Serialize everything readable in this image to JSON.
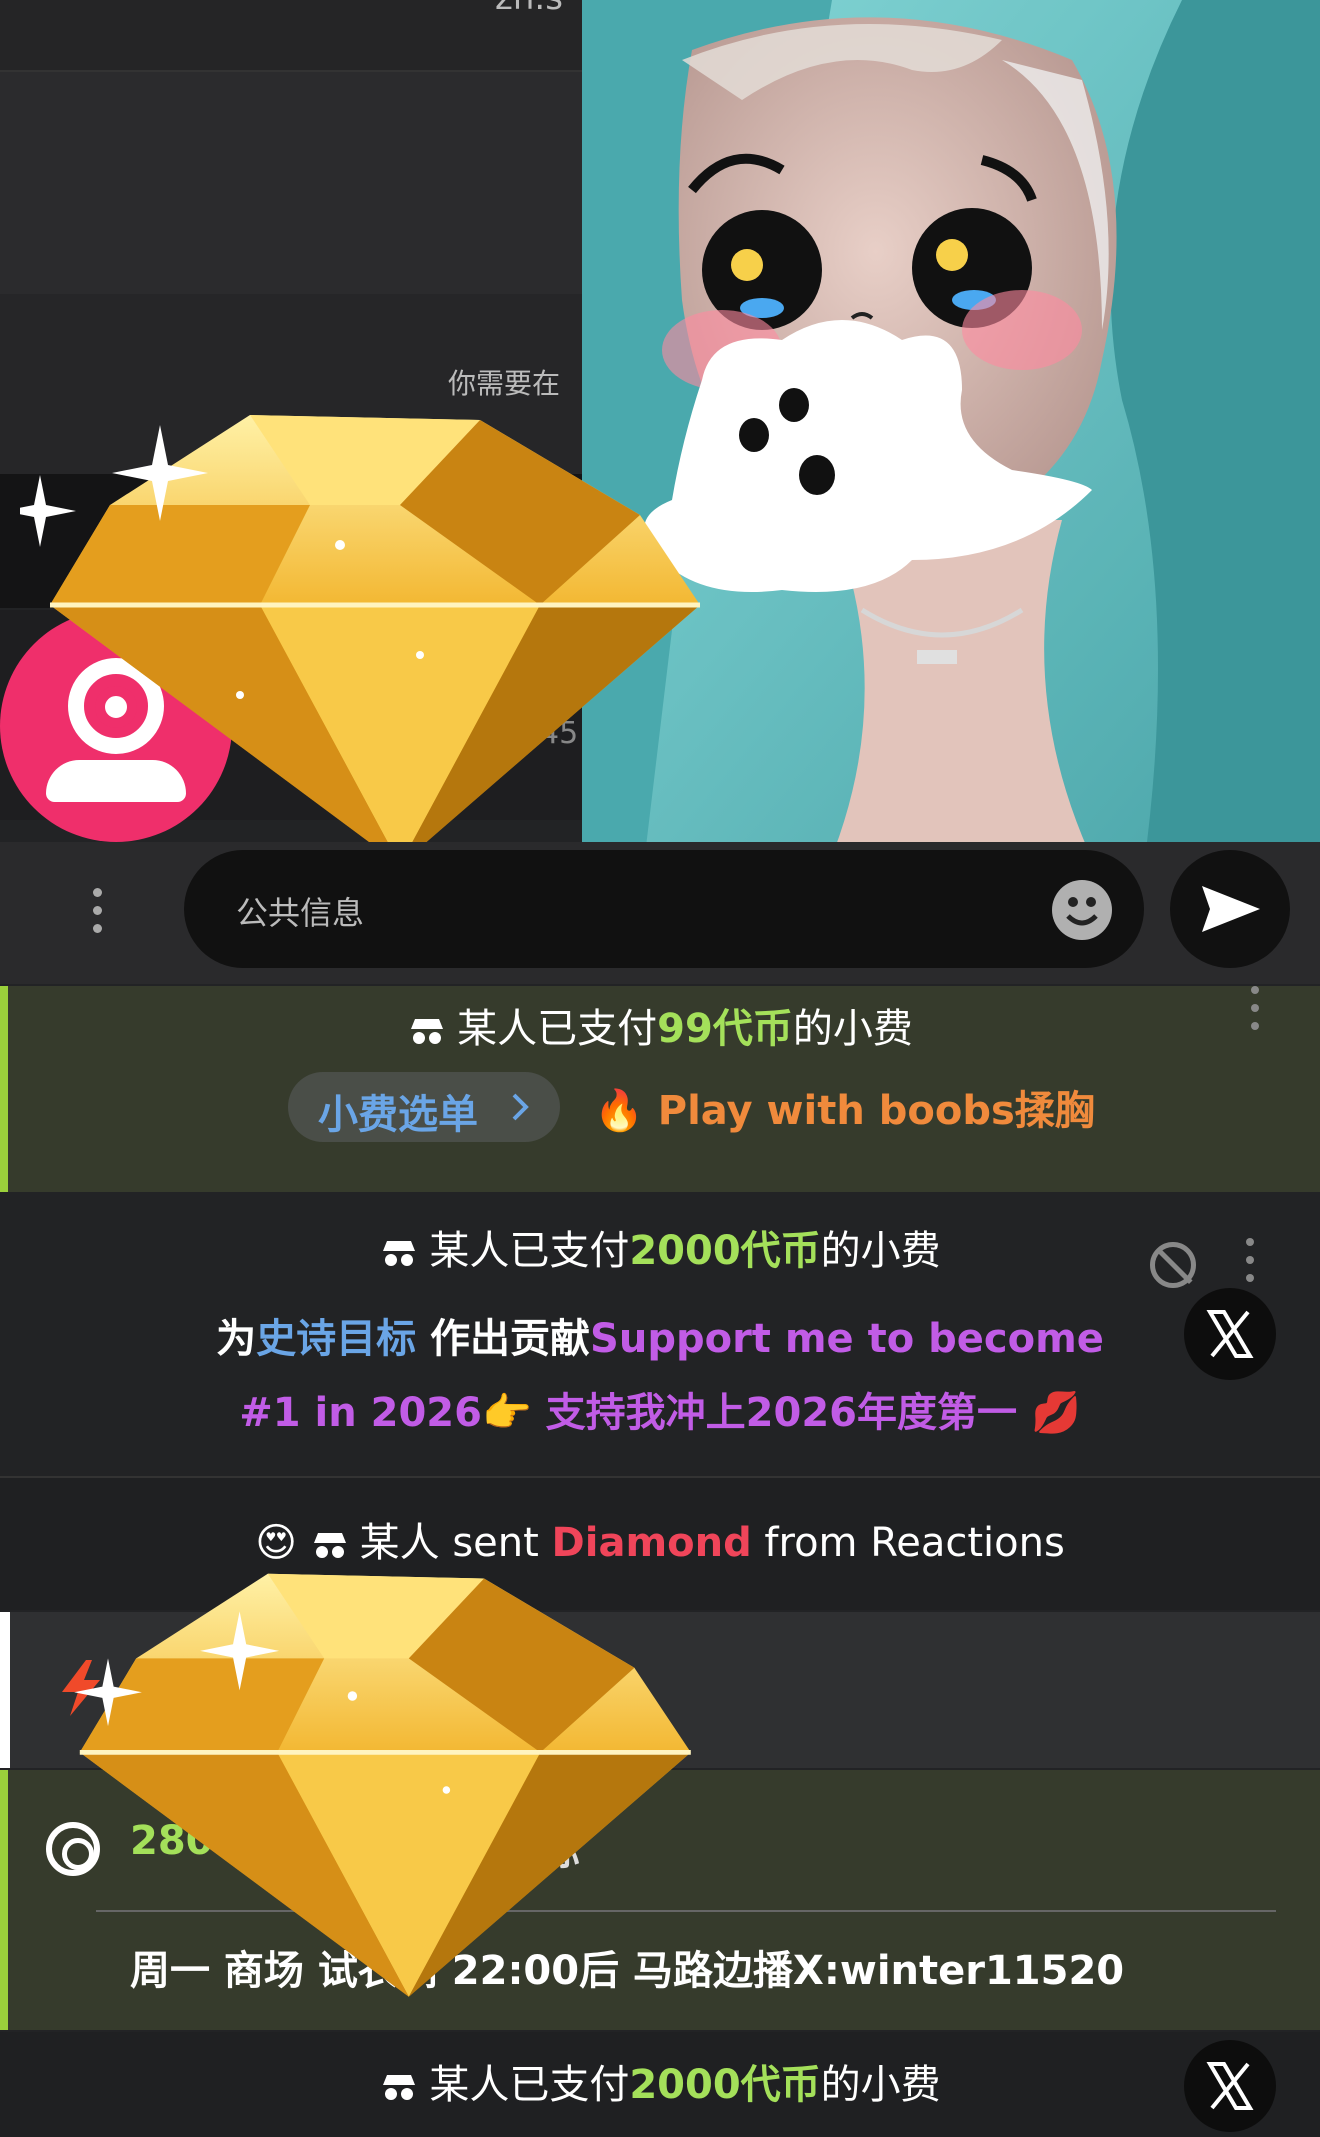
{
  "header": {
    "title_fragment": "zh.s"
  },
  "chat": {
    "notice_fragment": "你需要在",
    "input_placeholder": "公共信息",
    "side_count": "45"
  },
  "messages": [
    {
      "prefix": "某人已支付",
      "amount": "99代币",
      "suffix": "的小费",
      "menu_label": "小费选单",
      "menu_item": "Play with boobs揉胸"
    },
    {
      "prefix": "某人已支付",
      "amount": "2000代币",
      "suffix": "的小费",
      "goal_prefix": "为",
      "goal_label": "史诗目标",
      "goal_mid": " 作出贡献",
      "goal_text_1": "Support me to become",
      "goal_text_2": "#1 in 2026👉 支持我冲上2026年度第一",
      "goal_emoji": "💋"
    },
    {
      "emoji": "😍",
      "prefix": "某人 sent ",
      "gift": "Diamond",
      "suffix": " from Reactions"
    },
    {
      "goal_count": "28041",
      "goal_count_trail": "t",
      "goal_tail": "标",
      "schedule": "周一 商场 试衣间 22:00后 马路边播X:winter11520"
    },
    {
      "prefix": "某人已支付",
      "amount": "2000代币",
      "suffix": "的小费"
    }
  ],
  "colors": {
    "accent_green": "#a4e05a",
    "accent_blue": "#6aa5e6",
    "accent_purple": "#c15ce6",
    "accent_orange": "#f08a3c",
    "accent_red": "#f0455a",
    "logo_pink": "#ef2f6b"
  },
  "icons": [
    "spy-icon",
    "fire-icon",
    "ban-icon",
    "x-logo-icon",
    "send-icon",
    "emoji-icon",
    "target-icon",
    "bolt-icon",
    "kebab-icon",
    "chevron-right-icon"
  ]
}
